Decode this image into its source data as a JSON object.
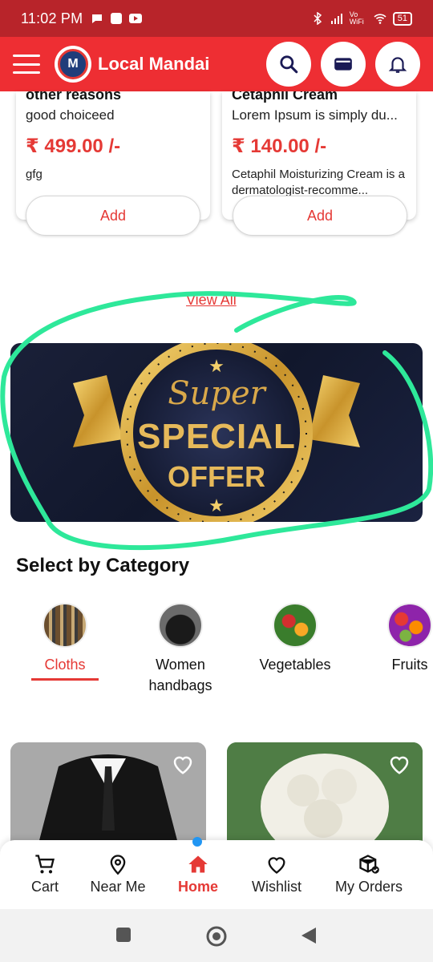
{
  "status_bar": {
    "time": "11:02 PM",
    "network": "Vo WiFi",
    "battery": "51"
  },
  "app_bar": {
    "title": "Local Mandai",
    "logo_text": "M"
  },
  "products": [
    {
      "title": "other reasons",
      "description": "good choiceed",
      "price": "₹ 499.00 /-",
      "extra": "gfg",
      "add_label": "Add"
    },
    {
      "title": "Cetaphil Cream",
      "description": "Lorem Ipsum is simply du...",
      "price": "₹ 140.00 /-",
      "extra": "Cetaphil Moisturizing Cream is a dermatologist-recomme...",
      "add_label": "Add"
    }
  ],
  "view_all": "View All",
  "banner": {
    "line1": "Super",
    "line2": "SPECIAL",
    "line3": "OFFER"
  },
  "categories_title": "Select by Category",
  "categories": [
    {
      "label": "Cloths",
      "active": true
    },
    {
      "label": "Women handbags",
      "active": false
    },
    {
      "label": "Vegetables",
      "active": false
    },
    {
      "label": "Fruits",
      "active": false
    }
  ],
  "bottom_nav": [
    {
      "label": "Cart",
      "icon": "cart-icon"
    },
    {
      "label": "Near Me",
      "icon": "location-pin-icon"
    },
    {
      "label": "Home",
      "icon": "home-icon",
      "active": true
    },
    {
      "label": "Wishlist",
      "icon": "heart-icon"
    },
    {
      "label": "My Orders",
      "icon": "box-icon"
    }
  ],
  "colors": {
    "status_bar": "#b8242a",
    "app_bar": "#ee2e33",
    "accent": "#e53935",
    "annotation": "#2ee89a"
  }
}
